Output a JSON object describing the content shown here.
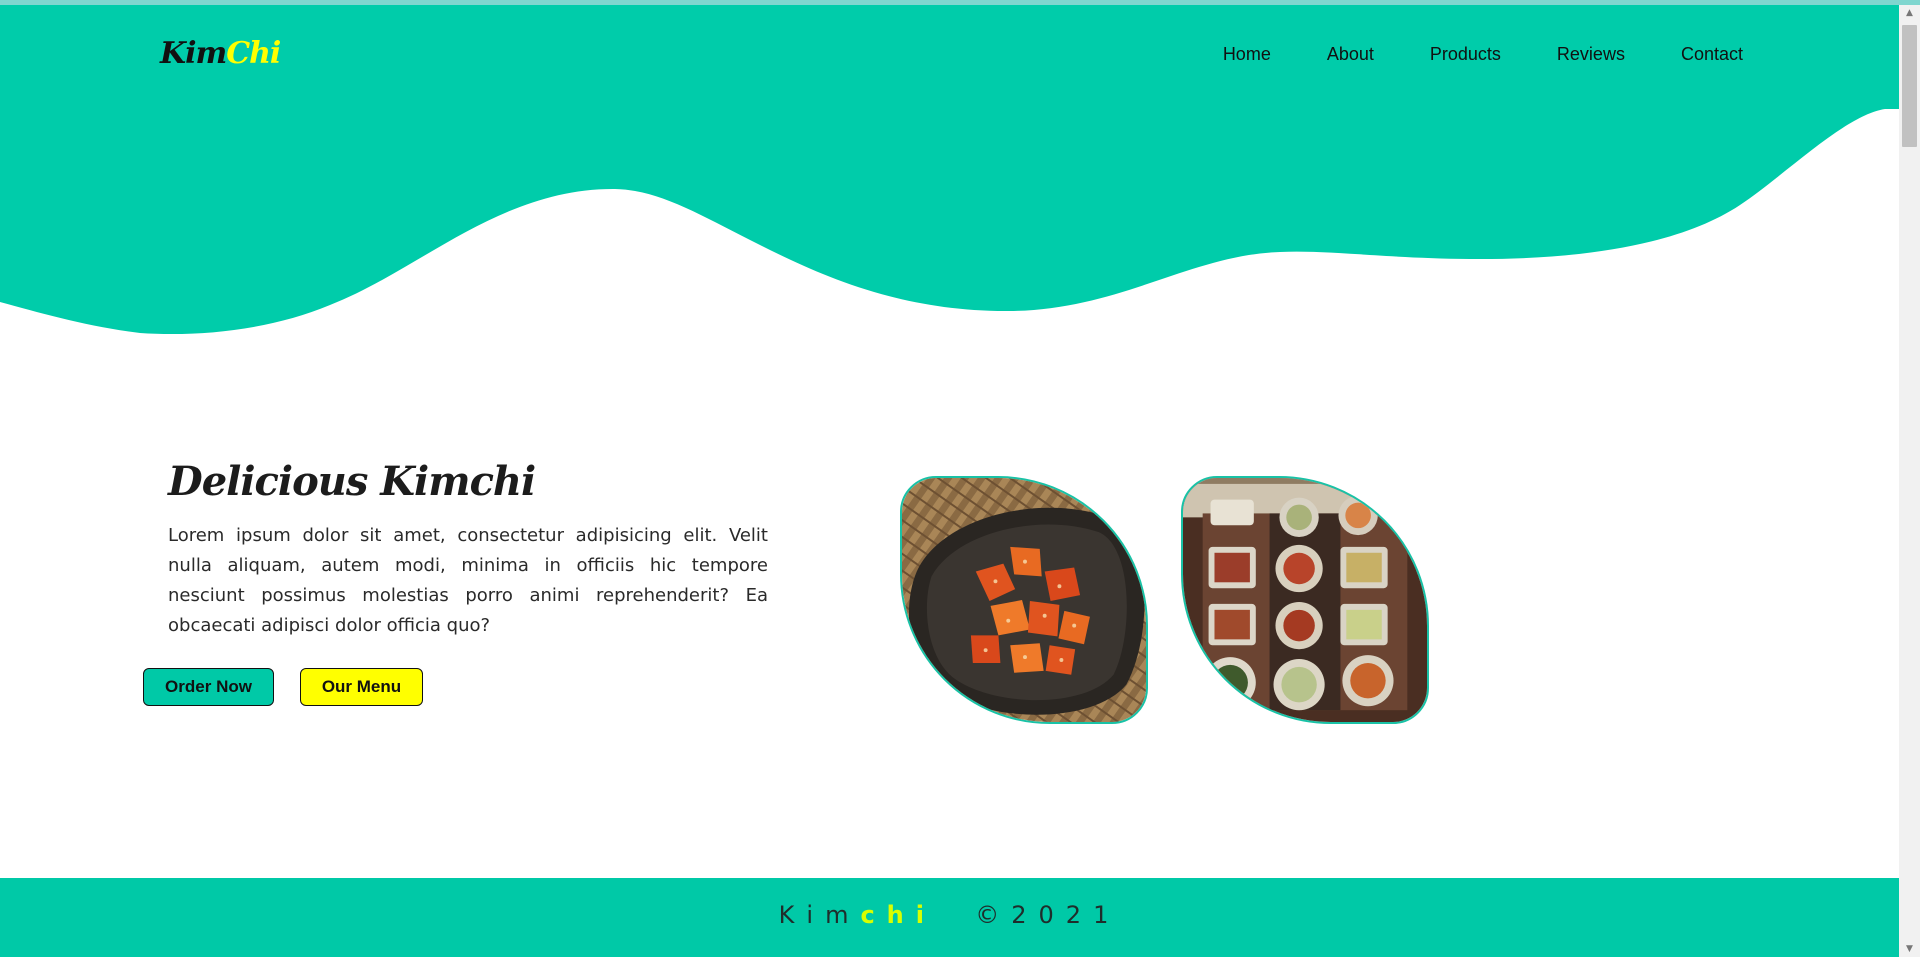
{
  "brand": {
    "part1": "Kim",
    "part2": "Chi"
  },
  "nav": {
    "items": [
      "Home",
      "About",
      "Products",
      "Reviews",
      "Contact"
    ]
  },
  "hero": {
    "title": "Delicious Kimchi",
    "text": "Lorem ipsum dolor sit amet, consectetur adipisicing elit. Velit nulla aliquam, autem modi, minima in officiis hic tempore nesciunt possimus molestias porro animi reprehenderit? Ea obcaecati adipisci dolor officia quo?",
    "order_button": "Order Now",
    "menu_button": "Our Menu"
  },
  "footer": {
    "part1": "Kim",
    "part2": "chi",
    "copyright": "©2021"
  },
  "colors": {
    "primary": "#00c9a7",
    "accent_yellow": "#ffff00",
    "footer_accent": "#d8ff00"
  },
  "icons": {
    "scroll_up": "scroll-up-arrow-icon",
    "scroll_down": "scroll-down-arrow-icon"
  }
}
